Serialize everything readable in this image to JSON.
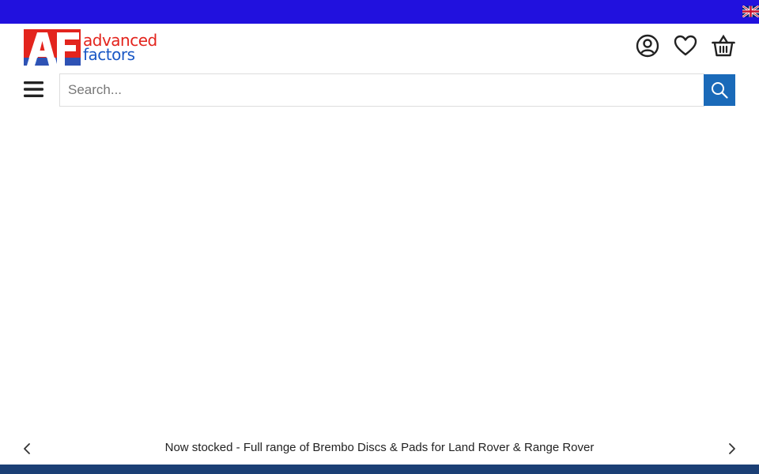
{
  "top_bar": {
    "color": "#2111de",
    "language_flag_icon": "uk-flag-icon"
  },
  "header": {
    "logo": {
      "mark": "AF",
      "line1": "advanced",
      "line2": "factors",
      "red": "#e3241d",
      "blue": "#1a58c5"
    },
    "icons": [
      "account-icon",
      "wishlist-heart-icon",
      "basket-icon"
    ]
  },
  "search": {
    "placeholder": "Search...",
    "value": "",
    "button_icon": "search-icon",
    "button_color": "#1a6ab9"
  },
  "ticker": {
    "message": "Now stocked - Full range of Brembo Discs & Pads for Land Rover & Range Rover",
    "prev_icon": "chevron-left-icon",
    "next_icon": "chevron-right-icon"
  },
  "bottom_bar": {
    "color": "#1b3f75"
  }
}
